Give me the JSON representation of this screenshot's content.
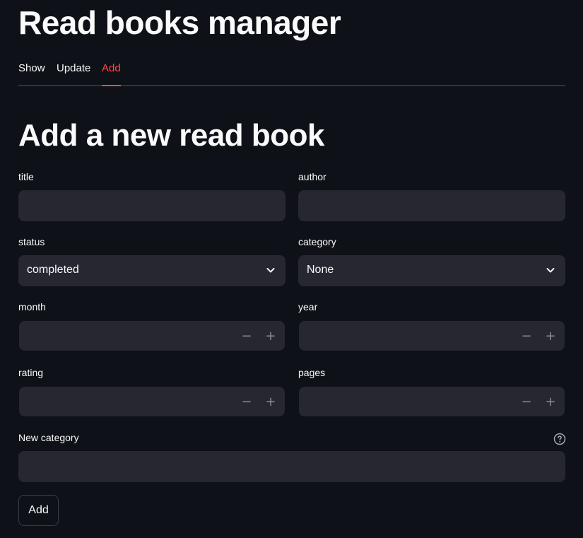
{
  "app": {
    "title": "Read books manager"
  },
  "tabs": [
    {
      "label": "Show",
      "active": false
    },
    {
      "label": "Update",
      "active": false
    },
    {
      "label": "Add",
      "active": true
    }
  ],
  "form": {
    "heading": "Add a new read book",
    "title": {
      "label": "title",
      "value": ""
    },
    "author": {
      "label": "author",
      "value": ""
    },
    "status": {
      "label": "status",
      "value": "completed"
    },
    "category": {
      "label": "category",
      "value": "None"
    },
    "month": {
      "label": "month",
      "value": ""
    },
    "year": {
      "label": "year",
      "value": ""
    },
    "rating": {
      "label": "rating",
      "value": ""
    },
    "pages": {
      "label": "pages",
      "value": ""
    },
    "new_category": {
      "label": "New category",
      "value": ""
    },
    "stepper": {
      "minus": "−",
      "plus": "+"
    },
    "submit_label": "Add"
  },
  "icons": {
    "dropdown": "chevron-down-icon",
    "help": "help-circle-icon"
  },
  "colors": {
    "background": "#0e1117",
    "input_background": "#262730",
    "accent": "#ff4b4b",
    "text": "#fafafa"
  }
}
